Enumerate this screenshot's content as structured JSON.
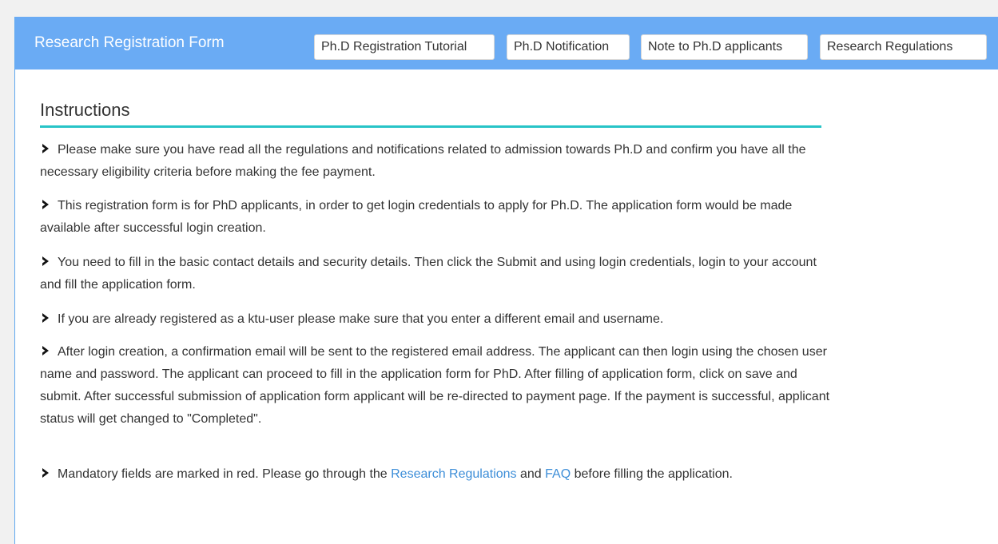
{
  "header": {
    "title": "Research Registration Form",
    "buttons": [
      "Ph.D Registration Tutorial",
      "Ph.D Notification",
      "Note to Ph.D applicants",
      "Research Regulations"
    ]
  },
  "instructions": {
    "heading": "Instructions",
    "items": [
      "Please make sure you have read all the regulations and notifications related to admission towards Ph.D and confirm you have all the necessary eligibility criteria before making the fee payment.",
      "This registration form is for PhD applicants, in order to get login credentials to apply for Ph.D. The application form would be made available after successful login creation.",
      "You need to fill in the basic contact details and security details. Then click the Submit and using login credentials, login to your account and fill the application form.",
      "If you are already registered as a ktu-user please make sure that you enter a different email and username.",
      "After login creation, a confirmation email will be sent to the registered email address. The applicant can then login using the chosen user name and password. The applicant can proceed to fill in the application form for PhD. After filling of application form, click on save and submit. After successful submission of application form applicant will be re-directed to payment page. If the payment is successful, applicant status will get changed to \"Completed\"."
    ],
    "last_item": {
      "text_before": "Mandatory fields are marked in red. Please go through the ",
      "link1": "Research Regulations",
      "text_middle": " and ",
      "link2": "FAQ",
      "text_after": " before filling the application."
    }
  },
  "colors": {
    "header_bg": "#6aabf4",
    "rule": "#27c4c7",
    "link": "#3d8ed8"
  },
  "icons": {
    "bullet": "chevron-right-icon"
  }
}
